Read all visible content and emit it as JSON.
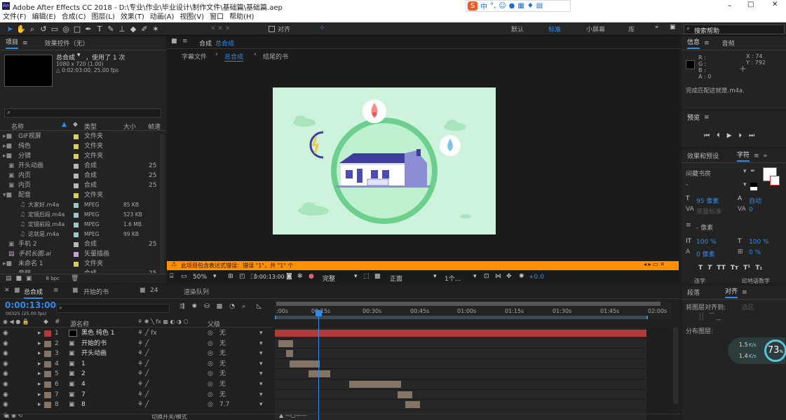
{
  "title": {
    "app_label": "Adobe After Effects CC 2018 - D:\\专业\\作业\\毕业设计\\制作文件\\基础篇\\基础篇.aep",
    "ime_label": "中",
    "minimize": "–",
    "maximize": "□",
    "close": "✕"
  },
  "menu": [
    "文件(F)",
    "编辑(E)",
    "合成(C)",
    "图层(L)",
    "效果(T)",
    "动画(A)",
    "视图(V)",
    "窗口",
    "帮助(H)"
  ],
  "toolbar": {
    "align": "对齐",
    "workspaces": [
      "默认",
      "标准",
      "小屏幕",
      "库"
    ],
    "search_placeholder": "搜索帮助"
  },
  "project": {
    "tab": "项目",
    "tab2": "效果控件（无）",
    "comp_name": "总合成",
    "used": "，使用了 1 次",
    "dims": "1080 x 720 (1.00)",
    "duration": "△ 0:02:03:00, 25.00 fps",
    "col_name": "名称",
    "col_type": "类型",
    "col_size": "大小",
    "col_rate": "帧速",
    "bpc": "8 bpc",
    "items": [
      {
        "name": "GIF视屏",
        "type": "文件夹",
        "size": "",
        "rate": "",
        "color": "#d9cf5a",
        "kind": "folder"
      },
      {
        "name": "纯色",
        "type": "文件夹",
        "size": "",
        "rate": "",
        "color": "#d9cf5a",
        "kind": "folder"
      },
      {
        "name": "分镜",
        "type": "文件夹",
        "size": "",
        "rate": "",
        "color": "#d9cf5a",
        "kind": "folder"
      },
      {
        "name": "开头动画",
        "type": "合成",
        "size": "",
        "rate": "25",
        "color": "#b8b8b8",
        "kind": "comp"
      },
      {
        "name": "内页",
        "type": "合成",
        "size": "",
        "rate": "25",
        "color": "#b8b8b8",
        "kind": "comp"
      },
      {
        "name": "内页",
        "type": "合成",
        "size": "",
        "rate": "25",
        "color": "#b8b8b8",
        "kind": "comp"
      },
      {
        "name": "配音",
        "type": "文件夹",
        "size": "",
        "rate": "",
        "color": "#d9cf5a",
        "kind": "folder"
      },
      {
        "name": "大家好.m4a",
        "type": "MPEG",
        "size": "85 KB",
        "rate": "",
        "color": "#9cc7c7",
        "kind": "audio"
      },
      {
        "name": "定镜后段.m4a",
        "type": "MPEG",
        "size": "523 KB",
        "rate": "",
        "color": "#9cc7c7",
        "kind": "audio"
      },
      {
        "name": "定镜前段.m4a",
        "type": "MPEG",
        "size": "1.6 MB",
        "rate": "",
        "color": "#9cc7c7",
        "kind": "audio"
      },
      {
        "name": "这就是.m4a",
        "type": "MPEG",
        "size": "99 KB",
        "rate": "",
        "color": "#9cc7c7",
        "kind": "audio"
      },
      {
        "name": "手机 2",
        "type": "合成",
        "size": "",
        "rate": "25",
        "color": "#b8b8b8",
        "kind": "comp"
      },
      {
        "name": "手机长图.ai",
        "type": "矢量插画",
        "size": "",
        "rate": "",
        "color": "#c9a0d8",
        "kind": "ai"
      },
      {
        "name": "未命名 1",
        "type": "文件夹",
        "size": "",
        "rate": "",
        "color": "#d9cf5a",
        "kind": "folder"
      },
      {
        "name": "音频",
        "type": "合成",
        "size": "",
        "rate": "25",
        "color": "#b8b8b8",
        "kind": "comp"
      }
    ]
  },
  "comp": {
    "tab_title": "合成",
    "tab_name": "总合成",
    "crumbs": [
      "字幕文件",
      "总合成",
      "结尾的书"
    ],
    "warning": "此项目包含表达式错误：错误 \"1\"，共 \"1\" 个",
    "zoom": "50%",
    "time": "0:00:13:00",
    "quality": "完整",
    "view": "正面",
    "views": "1个...",
    "exposure": "+0.0"
  },
  "info": {
    "tab": "信息",
    "tab2": "音频",
    "r": "R :",
    "g": "G :",
    "b": "B :",
    "a": "A : 0",
    "x": "X : 74",
    "y": "Y : 792",
    "msg": "完成匹配这就是.m4a."
  },
  "preview": {
    "tab": "预览"
  },
  "char": {
    "tab": "效果和预设",
    "tab2": "字符",
    "font": "间藏书房",
    "style": "-",
    "size": "95 像素",
    "leading": "自动",
    "kern": "度量标准",
    "track": "0",
    "unit": "- 像素",
    "vscale": "100 %",
    "hscale": "100 %",
    "baseline": "0 像素",
    "tsume": "0 %",
    "ligature": "连字",
    "hindi": "印地语数字"
  },
  "para": {
    "tab": "段落",
    "tab2": "对齐",
    "align_to": "将图层对齐到:",
    "sel": "选区",
    "dist": "分布图层:"
  },
  "net": {
    "up": "1.5",
    "down": "1.4",
    "unit": "K/s",
    "pct": "73",
    "pct_unit": "%"
  },
  "timeline": {
    "tab": "总合成",
    "tab2": "开始的书",
    "tab3": "24",
    "tab4": "渲染队列",
    "time": "0:00:13:00",
    "fps": "00325 (25.00 fps)",
    "col_name": "源名称",
    "col_parent": "父级",
    "switch_label": "切换开关/模式",
    "ruler": [
      ":00s",
      "00:15s",
      "00:30s",
      "00:45s",
      "01:00s",
      "01:15s",
      "01:30s",
      "01:45s",
      "02:00s"
    ],
    "layers": [
      {
        "num": "1",
        "name": "黑色 纯色 1",
        "parent": "无",
        "color": "#b33a3a"
      },
      {
        "num": "2",
        "name": "开始的书",
        "parent": "无",
        "color": "#837465"
      },
      {
        "num": "3",
        "name": "开头动画",
        "parent": "无",
        "color": "#837465"
      },
      {
        "num": "4",
        "name": "1",
        "parent": "无",
        "color": "#837465"
      },
      {
        "num": "5",
        "name": "2",
        "parent": "无",
        "color": "#837465"
      },
      {
        "num": "6",
        "name": "4",
        "parent": "无",
        "color": "#837465"
      },
      {
        "num": "7",
        "name": "7",
        "parent": "无",
        "color": "#837465"
      },
      {
        "num": "8",
        "name": "8",
        "parent": "7.7",
        "color": "#837465"
      }
    ],
    "bars": [
      [
        0,
        100
      ],
      [
        1,
        4
      ],
      [
        3,
        2
      ],
      [
        4,
        8
      ],
      [
        9,
        6
      ],
      [
        20,
        14
      ],
      [
        33,
        4
      ],
      [
        35,
        4
      ]
    ]
  },
  "colors": {
    "accent": "#2d8ceb",
    "warning": "#ff9000",
    "scene_bg": "#cdf3dd",
    "circle": "#6dcf8e",
    "house": "#3e3e9e"
  }
}
